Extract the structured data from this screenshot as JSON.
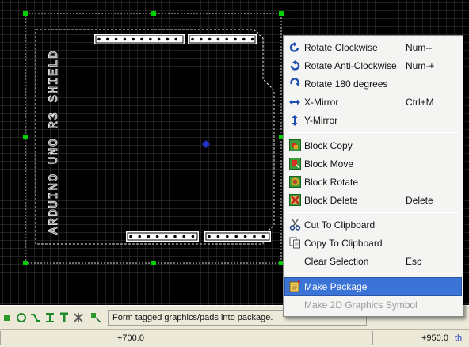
{
  "canvas": {
    "silkscreen_label": "ARDUINO UNO R3 SHIELD",
    "colors": {
      "background": "#000000",
      "grid": "#3a3a3a",
      "outline": "#ffffff",
      "handles": "#00cc00",
      "origin": "#1a2ab8"
    }
  },
  "context_menu": {
    "items": [
      {
        "label": "Rotate Clockwise",
        "shortcut": "Num--",
        "icon": "rotate-clockwise-icon"
      },
      {
        "label": "Rotate Anti-Clockwise",
        "shortcut": "Num-+",
        "icon": "rotate-anticlockwise-icon"
      },
      {
        "label": "Rotate 180 degrees",
        "shortcut": "",
        "icon": "rotate-180-icon"
      },
      {
        "label": "X-Mirror",
        "shortcut": "Ctrl+M",
        "icon": "x-mirror-icon"
      },
      {
        "label": "Y-Mirror",
        "shortcut": "",
        "icon": "y-mirror-icon"
      },
      {
        "label": "Block Copy",
        "shortcut": "",
        "icon": "block-copy-icon"
      },
      {
        "label": "Block Move",
        "shortcut": "",
        "icon": "block-move-icon"
      },
      {
        "label": "Block Rotate",
        "shortcut": "",
        "icon": "block-rotate-icon"
      },
      {
        "label": "Block Delete",
        "shortcut": "Delete",
        "icon": "block-delete-icon"
      },
      {
        "label": "Cut To Clipboard",
        "shortcut": "",
        "icon": "scissors-icon"
      },
      {
        "label": "Copy To Clipboard",
        "shortcut": "",
        "icon": "copy-icon"
      },
      {
        "label": "Clear Selection",
        "shortcut": "Esc",
        "icon": ""
      },
      {
        "label": "Make Package",
        "shortcut": "",
        "icon": "make-package-icon",
        "state": "highlighted"
      },
      {
        "label": "Make 2D Graphics Symbol",
        "shortcut": "",
        "icon": "",
        "state": "disabled"
      }
    ]
  },
  "status": {
    "message": "Form tagged graphics/pads into package.",
    "x_coord": "+700.0",
    "y_coord": "+950.0",
    "unit": "th"
  },
  "toolbar": {
    "icons": [
      "pad-icon",
      "via-icon",
      "track-icon",
      "jumper-icon",
      "text-icon",
      "component-icon",
      "block-icon"
    ]
  }
}
